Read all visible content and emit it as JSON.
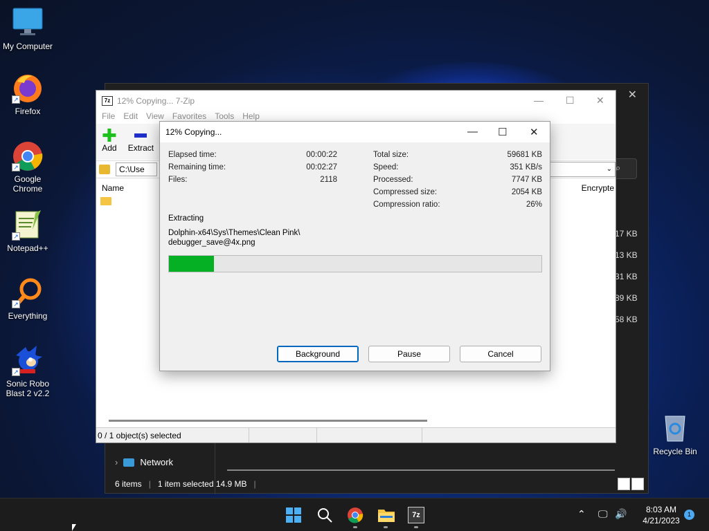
{
  "desktop": {
    "icons": [
      {
        "label": "My Computer"
      },
      {
        "label": "Firefox"
      },
      {
        "label": "Google Chrome"
      },
      {
        "label": "Notepad++"
      },
      {
        "label": "Everything"
      },
      {
        "label": "Sonic Robo Blast 2 v2.2"
      }
    ],
    "recycle_bin": "Recycle Bin"
  },
  "explorer": {
    "sizes": [
      "17 KB",
      "13 KB",
      "31 KB",
      "89 KB",
      "58 KB"
    ],
    "nav_network": "Network",
    "status_items": "6 items",
    "status_selected": "1 item selected  14.9 MB"
  },
  "zip_window": {
    "title": "12% Copying... 7-Zip",
    "menu": [
      "File",
      "Edit",
      "View",
      "Favorites",
      "Tools",
      "Help"
    ],
    "toolbar": {
      "add": "Add",
      "extract": "Extract"
    },
    "path": "C:\\Use",
    "columns": {
      "name": "Name",
      "encrypted": "Encrypte"
    },
    "status": "0 / 1 object(s) selected"
  },
  "dialog": {
    "title": "12% Copying...",
    "left_stats": [
      {
        "label": "Elapsed time:",
        "value": "00:00:22"
      },
      {
        "label": "Remaining time:",
        "value": "00:02:27"
      },
      {
        "label": "Files:",
        "value": "2118"
      }
    ],
    "right_stats": [
      {
        "label": "Total size:",
        "value": "59681 KB"
      },
      {
        "label": "Speed:",
        "value": "351 KB/s"
      },
      {
        "label": "Processed:",
        "value": "7747 KB"
      },
      {
        "label": "Compressed size:",
        "value": "2054 KB"
      },
      {
        "label": "Compression ratio:",
        "value": "26%"
      }
    ],
    "operation": "Extracting",
    "file_line1": "Dolphin-x64\\Sys\\Themes\\Clean Pink\\",
    "file_line2": "debugger_save@4x.png",
    "progress": 0.12,
    "buttons": {
      "background": "Background",
      "pause": "Pause",
      "cancel": "Cancel"
    }
  },
  "taskbar": {
    "time": "8:03 AM",
    "date": "4/21/2023",
    "notification_count": "1",
    "pinned": [
      "windows-start-icon",
      "search-icon",
      "chrome-icon",
      "file-explorer-icon",
      "7zip-icon"
    ]
  },
  "colors": {
    "progress_fill": "#06b025",
    "accent": "#0067c0"
  }
}
